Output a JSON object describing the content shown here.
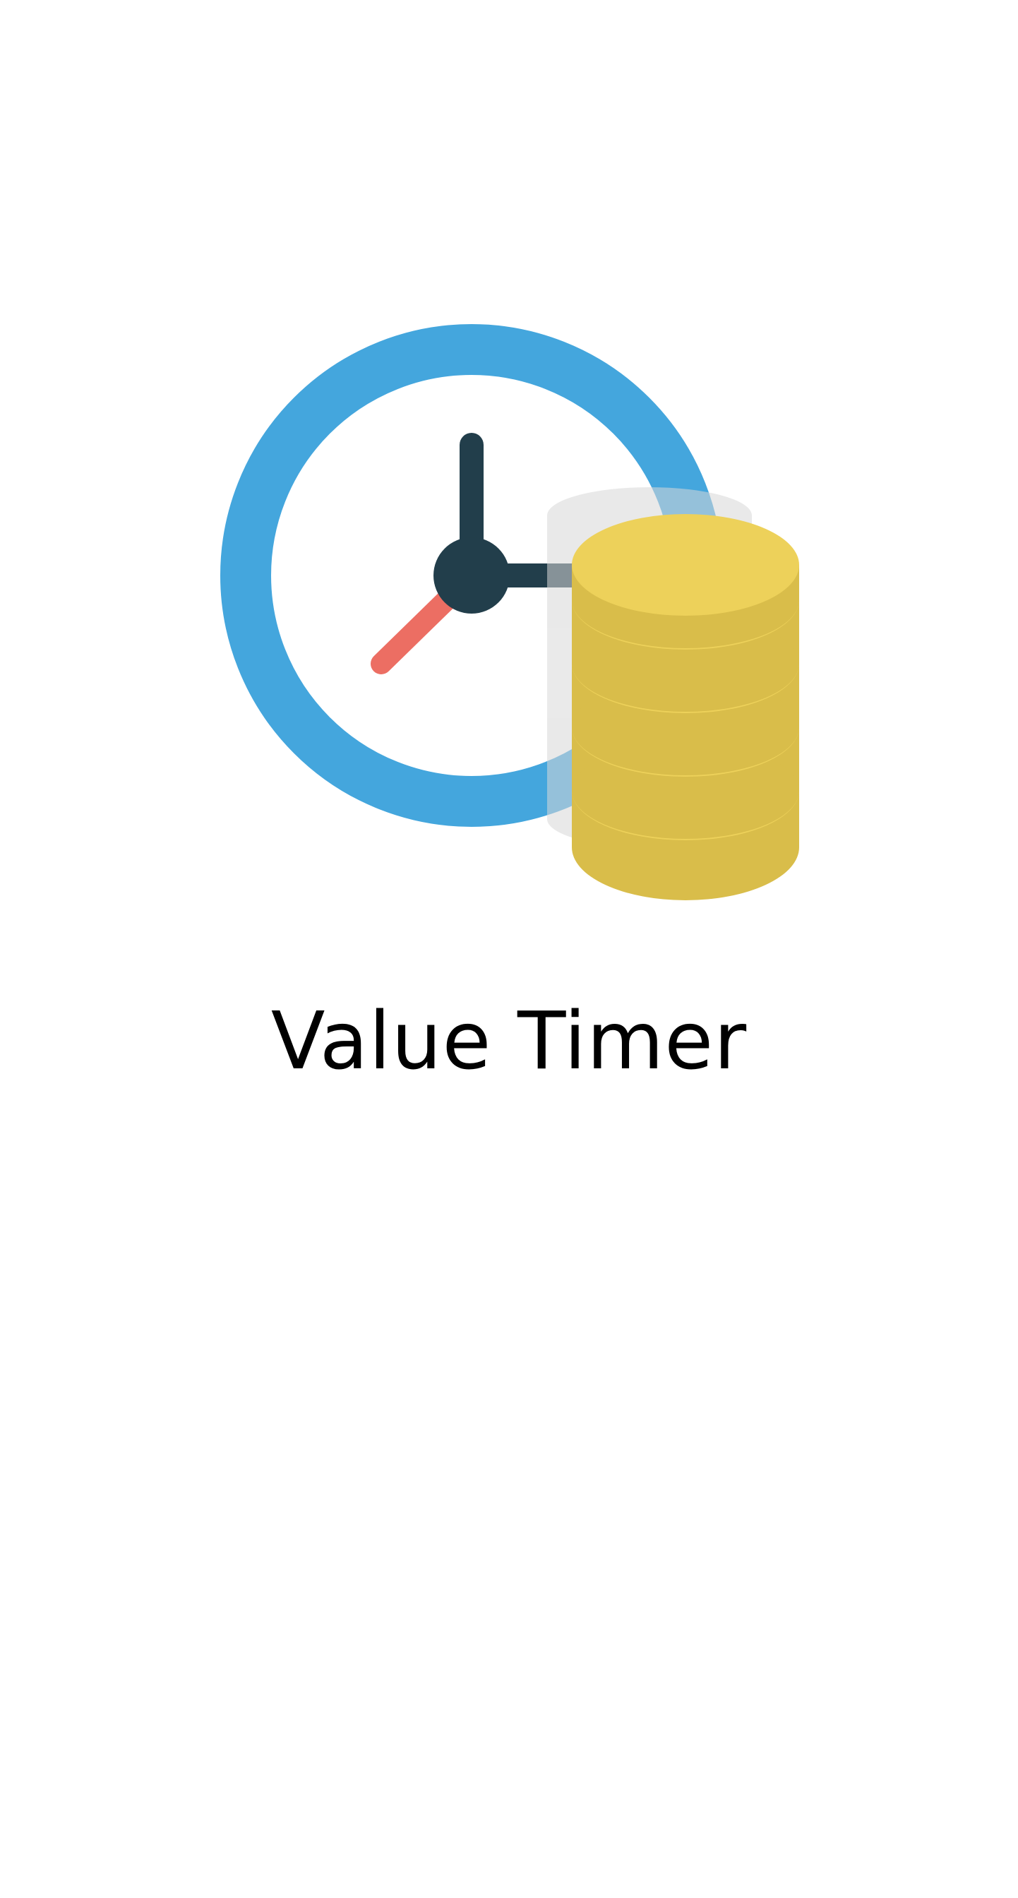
{
  "app": {
    "title": "Value Timer"
  },
  "icons": {
    "logo": "clock-with-coins-icon"
  },
  "colors": {
    "background": "#ffffff",
    "clock_ring": "#44A6DD",
    "clock_hands": "#223E4B",
    "second_hand": "#EC6E63",
    "coin_top": "#EDD15A",
    "coin_side": "#D9BD4A",
    "coin_shadow": "#E6E6E6",
    "title_text": "#000000"
  }
}
